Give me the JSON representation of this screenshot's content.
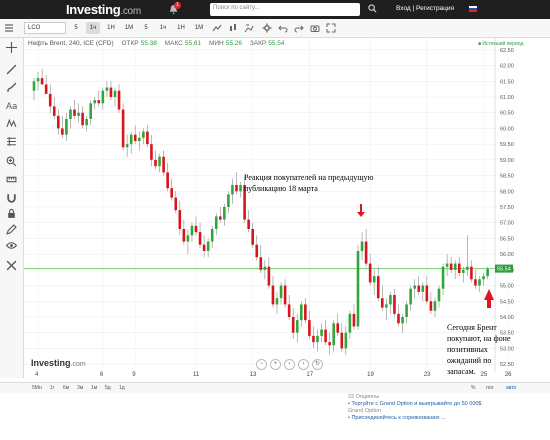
{
  "header": {
    "logo": "Investing",
    "logo_domain": ".com",
    "notification_count": "1",
    "search_placeholder": "Поиск по сайту...",
    "login": "Вход",
    "separator": "|",
    "register": "Регистрация"
  },
  "toolbar": {
    "symbol": "LCO",
    "intervals": [
      "5",
      "1ч",
      "1Н",
      "1М",
      "5",
      "1ч",
      "1Н",
      "1М"
    ],
    "active_interval": "1ч"
  },
  "legend": {
    "instrument": "Нефть Brent, 240, ICE (CFD)",
    "open_label": "ОТКР",
    "open_value": "55.38",
    "high_label": "МАКС",
    "high_value": "55.61",
    "low_label": "МИН",
    "low_value": "55.26",
    "close_label": "ЗАКР",
    "close_value": "55.54",
    "period": "■ Истекший период"
  },
  "annotations": {
    "first": "Реакция покупателей на предыдущую публикацию 18 марта",
    "second": "Сегодня Брент покупают, на фоне позитивных ожиданий по запасам."
  },
  "watermark": {
    "logo": "Investing",
    "domain": ".com"
  },
  "bottom": {
    "ranges": [
      "5Мн",
      "1г",
      "6м",
      "3м",
      "1м",
      "5д",
      "1д"
    ],
    "right": [
      "%",
      "лог",
      "авто"
    ]
  },
  "ad": {
    "source1": "22 Опционы",
    "title1": "Торгуйте с Grand Option и выигрывайте до 50 000$",
    "source2": "Grand Option",
    "title2": "Присоединяйтесь к соревнованию ...",
    "bullet": "•"
  },
  "chart_data": {
    "type": "candlestick",
    "symbol": "LCO",
    "price_ticks": [
      "62.50",
      "62.00",
      "61.50",
      "61.00",
      "60.50",
      "60.00",
      "59.50",
      "59.00",
      "58.50",
      "58.00",
      "57.50",
      "57.00",
      "56.50",
      "56.00",
      "55.50",
      "55.00",
      "54.50",
      "54.00",
      "53.50",
      "53.00",
      "52.50"
    ],
    "ylim": [
      52.25,
      62.75
    ],
    "current_price": "55.54",
    "date_ticks": [
      {
        "label": "4",
        "i": 1
      },
      {
        "label": "6",
        "i": 17
      },
      {
        "label": "9",
        "i": 25
      },
      {
        "label": "11",
        "i": 40
      },
      {
        "label": "13",
        "i": 54
      },
      {
        "label": "17",
        "i": 68
      },
      {
        "label": "19",
        "i": 83
      },
      {
        "label": "23",
        "i": 97
      },
      {
        "label": "25",
        "i": 111
      },
      {
        "label": "26",
        "i": 117
      }
    ],
    "candles": [
      [
        61.2,
        61.6,
        60.9,
        61.5
      ],
      [
        61.5,
        61.8,
        61.2,
        61.6
      ],
      [
        61.6,
        61.9,
        61.4,
        61.4
      ],
      [
        61.4,
        61.7,
        61.1,
        61.1
      ],
      [
        61.1,
        61.4,
        60.5,
        60.7
      ],
      [
        60.7,
        61.0,
        60.3,
        60.4
      ],
      [
        60.4,
        60.6,
        59.8,
        60.0
      ],
      [
        60.0,
        60.4,
        59.7,
        59.8
      ],
      [
        59.8,
        60.5,
        59.6,
        60.3
      ],
      [
        60.3,
        60.7,
        60.0,
        60.6
      ],
      [
        60.6,
        60.9,
        60.3,
        60.4
      ],
      [
        60.4,
        60.8,
        60.2,
        60.5
      ],
      [
        60.5,
        60.7,
        60.0,
        60.1
      ],
      [
        60.1,
        60.4,
        59.9,
        60.3
      ],
      [
        60.3,
        60.9,
        60.1,
        60.8
      ],
      [
        60.8,
        61.0,
        60.6,
        60.9
      ],
      [
        60.9,
        61.2,
        60.7,
        60.8
      ],
      [
        60.8,
        61.3,
        60.6,
        61.2
      ],
      [
        61.2,
        61.5,
        61.0,
        61.3
      ],
      [
        61.3,
        61.5,
        60.9,
        61.0
      ],
      [
        61.0,
        61.3,
        60.7,
        61.2
      ],
      [
        61.2,
        61.4,
        60.5,
        60.6
      ],
      [
        60.6,
        60.8,
        59.3,
        59.4
      ],
      [
        59.4,
        59.8,
        59.1,
        59.5
      ],
      [
        59.5,
        59.9,
        59.2,
        59.8
      ],
      [
        59.8,
        60.1,
        59.5,
        59.6
      ],
      [
        59.6,
        59.9,
        59.3,
        59.7
      ],
      [
        59.7,
        60.0,
        59.5,
        59.9
      ],
      [
        59.9,
        60.1,
        59.4,
        59.5
      ],
      [
        59.5,
        59.8,
        58.8,
        59.0
      ],
      [
        59.0,
        59.3,
        58.7,
        58.8
      ],
      [
        58.8,
        59.2,
        58.6,
        59.1
      ],
      [
        59.1,
        59.3,
        58.5,
        58.6
      ],
      [
        58.6,
        58.9,
        58.0,
        58.1
      ],
      [
        58.1,
        58.4,
        57.7,
        57.8
      ],
      [
        57.8,
        58.0,
        57.3,
        57.4
      ],
      [
        57.4,
        57.7,
        56.6,
        56.8
      ],
      [
        56.8,
        57.1,
        56.3,
        56.4
      ],
      [
        56.4,
        56.8,
        56.0,
        56.6
      ],
      [
        56.6,
        57.0,
        56.4,
        56.9
      ],
      [
        56.9,
        57.2,
        56.6,
        56.7
      ],
      [
        56.7,
        57.0,
        56.2,
        56.3
      ],
      [
        56.3,
        56.6,
        55.9,
        56.1
      ],
      [
        56.1,
        56.5,
        55.9,
        56.4
      ],
      [
        56.4,
        56.9,
        56.2,
        56.8
      ],
      [
        56.8,
        57.3,
        56.6,
        57.2
      ],
      [
        57.2,
        57.5,
        57.0,
        57.1
      ],
      [
        57.1,
        57.6,
        56.9,
        57.5
      ],
      [
        57.5,
        58.0,
        57.3,
        57.9
      ],
      [
        57.9,
        58.4,
        57.6,
        58.2
      ],
      [
        58.2,
        58.6,
        57.9,
        58.0
      ],
      [
        58.0,
        58.3,
        57.8,
        58.2
      ],
      [
        58.2,
        58.5,
        57.0,
        57.1
      ],
      [
        57.1,
        57.4,
        56.7,
        56.8
      ],
      [
        56.8,
        57.0,
        56.2,
        56.3
      ],
      [
        56.3,
        56.6,
        55.8,
        55.9
      ],
      [
        55.9,
        56.3,
        55.4,
        55.5
      ],
      [
        55.5,
        55.8,
        55.2,
        55.6
      ],
      [
        55.6,
        55.9,
        54.9,
        55.0
      ],
      [
        55.0,
        55.3,
        54.3,
        54.4
      ],
      [
        54.4,
        54.8,
        54.1,
        54.6
      ],
      [
        54.6,
        55.1,
        54.4,
        55.0
      ],
      [
        55.0,
        55.2,
        54.3,
        54.4
      ],
      [
        54.4,
        54.7,
        53.9,
        54.0
      ],
      [
        54.0,
        54.3,
        53.3,
        53.5
      ],
      [
        53.5,
        54.1,
        53.2,
        53.9
      ],
      [
        53.9,
        54.5,
        53.7,
        54.4
      ],
      [
        54.4,
        54.6,
        53.8,
        53.9
      ],
      [
        53.9,
        54.2,
        53.3,
        53.4
      ],
      [
        53.4,
        53.7,
        53.0,
        53.2
      ],
      [
        53.2,
        53.6,
        52.9,
        53.4
      ],
      [
        53.4,
        53.8,
        53.2,
        53.6
      ],
      [
        53.6,
        53.9,
        53.1,
        53.2
      ],
      [
        53.2,
        53.5,
        52.8,
        53.1
      ],
      [
        53.1,
        53.9,
        52.9,
        53.8
      ],
      [
        53.8,
        54.1,
        53.4,
        53.5
      ],
      [
        53.5,
        53.8,
        52.9,
        53.0
      ],
      [
        53.0,
        53.7,
        52.8,
        53.5
      ],
      [
        53.5,
        54.2,
        53.3,
        54.1
      ],
      [
        54.1,
        54.4,
        53.6,
        53.7
      ],
      [
        53.7,
        56.3,
        53.6,
        56.1
      ],
      [
        56.1,
        56.7,
        55.8,
        56.4
      ],
      [
        56.4,
        56.8,
        55.6,
        55.7
      ],
      [
        55.7,
        56.0,
        55.0,
        55.1
      ],
      [
        55.1,
        55.5,
        54.7,
        55.3
      ],
      [
        55.3,
        55.6,
        54.5,
        54.6
      ],
      [
        54.6,
        55.0,
        54.2,
        54.3
      ],
      [
        54.3,
        54.6,
        53.9,
        54.4
      ],
      [
        54.4,
        54.8,
        54.1,
        54.7
      ],
      [
        54.7,
        54.9,
        54.0,
        54.1
      ],
      [
        54.1,
        54.4,
        53.7,
        53.8
      ],
      [
        53.8,
        54.1,
        53.5,
        54.0
      ],
      [
        54.0,
        54.5,
        53.8,
        54.4
      ],
      [
        54.4,
        55.0,
        54.2,
        54.9
      ],
      [
        54.9,
        55.2,
        54.6,
        55.0
      ],
      [
        55.0,
        55.3,
        54.7,
        54.8
      ],
      [
        54.8,
        55.1,
        54.5,
        55.0
      ],
      [
        55.0,
        55.3,
        54.4,
        54.5
      ],
      [
        54.5,
        54.8,
        54.1,
        54.2
      ],
      [
        54.2,
        54.6,
        54.0,
        54.5
      ],
      [
        54.5,
        55.0,
        54.3,
        54.9
      ],
      [
        54.9,
        55.7,
        54.7,
        55.6
      ],
      [
        55.6,
        56.0,
        55.3,
        55.7
      ],
      [
        55.7,
        55.9,
        55.4,
        55.5
      ],
      [
        55.5,
        55.8,
        55.2,
        55.7
      ],
      [
        55.7,
        55.9,
        55.3,
        55.4
      ],
      [
        55.4,
        55.6,
        55.1,
        55.5
      ],
      [
        55.5,
        56.6,
        55.3,
        55.6
      ],
      [
        55.6,
        55.8,
        55.1,
        55.2
      ],
      [
        55.2,
        55.5,
        54.9,
        55.0
      ],
      [
        55.0,
        55.3,
        54.8,
        55.2
      ],
      [
        55.2,
        55.4,
        55.0,
        55.3
      ],
      [
        55.3,
        55.6,
        55.2,
        55.54
      ]
    ]
  }
}
